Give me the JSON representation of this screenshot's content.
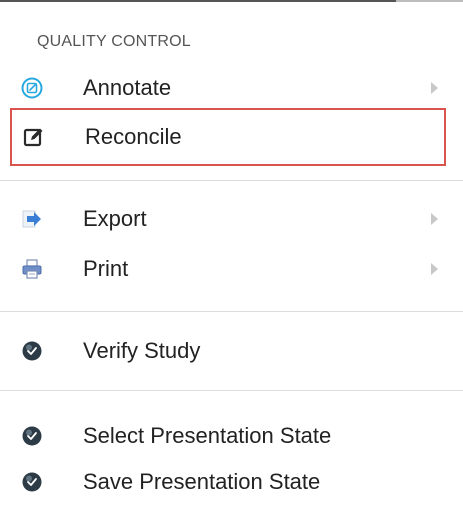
{
  "menu": {
    "section_title": "QUALITY CONTROL",
    "items": [
      {
        "label": "Annotate",
        "icon": "annotate-icon",
        "has_submenu": true
      },
      {
        "label": "Reconcile",
        "icon": "edit-icon",
        "has_submenu": false,
        "highlighted": true
      },
      {
        "label": "Export",
        "icon": "export-arrow-icon",
        "has_submenu": true
      },
      {
        "label": "Print",
        "icon": "printer-icon",
        "has_submenu": true
      },
      {
        "label": "Verify Study",
        "icon": "verify-icon",
        "has_submenu": false
      },
      {
        "label": "Select Presentation State",
        "icon": "presentation-state-icon",
        "has_submenu": false
      },
      {
        "label": "Save Presentation State",
        "icon": "presentation-state-icon",
        "has_submenu": false
      }
    ]
  },
  "colors": {
    "highlight_border": "#d9534f",
    "annotate_accent": "#29a8e0",
    "export_accent": "#3a7fd5",
    "text": "#222222",
    "section_title": "#555555"
  }
}
